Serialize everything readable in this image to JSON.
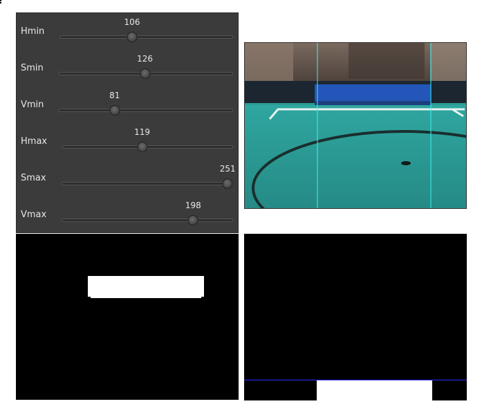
{
  "trackbars": [
    {
      "label": "Hmin",
      "value": "106",
      "fraction": 0.4157
    },
    {
      "label": "Smin",
      "value": "126",
      "fraction": 0.4941
    },
    {
      "label": "Vmin",
      "value": "81",
      "fraction": 0.3176
    },
    {
      "label": "Hmax",
      "value": "119",
      "fraction": 0.4667
    },
    {
      "label": "Smax",
      "value": "251",
      "fraction": 0.9843
    },
    {
      "label": "Vmax",
      "value": "198",
      "fraction": 0.7765
    }
  ],
  "colors": {
    "panel_bg": "#3b3b3b",
    "text": "#e8e8e8",
    "guide_line": "#3ff0f0",
    "horizon_line": "#2d2dff",
    "field": "#2b9c96"
  },
  "icons": {
    "handle": "slider-knob-icon"
  }
}
